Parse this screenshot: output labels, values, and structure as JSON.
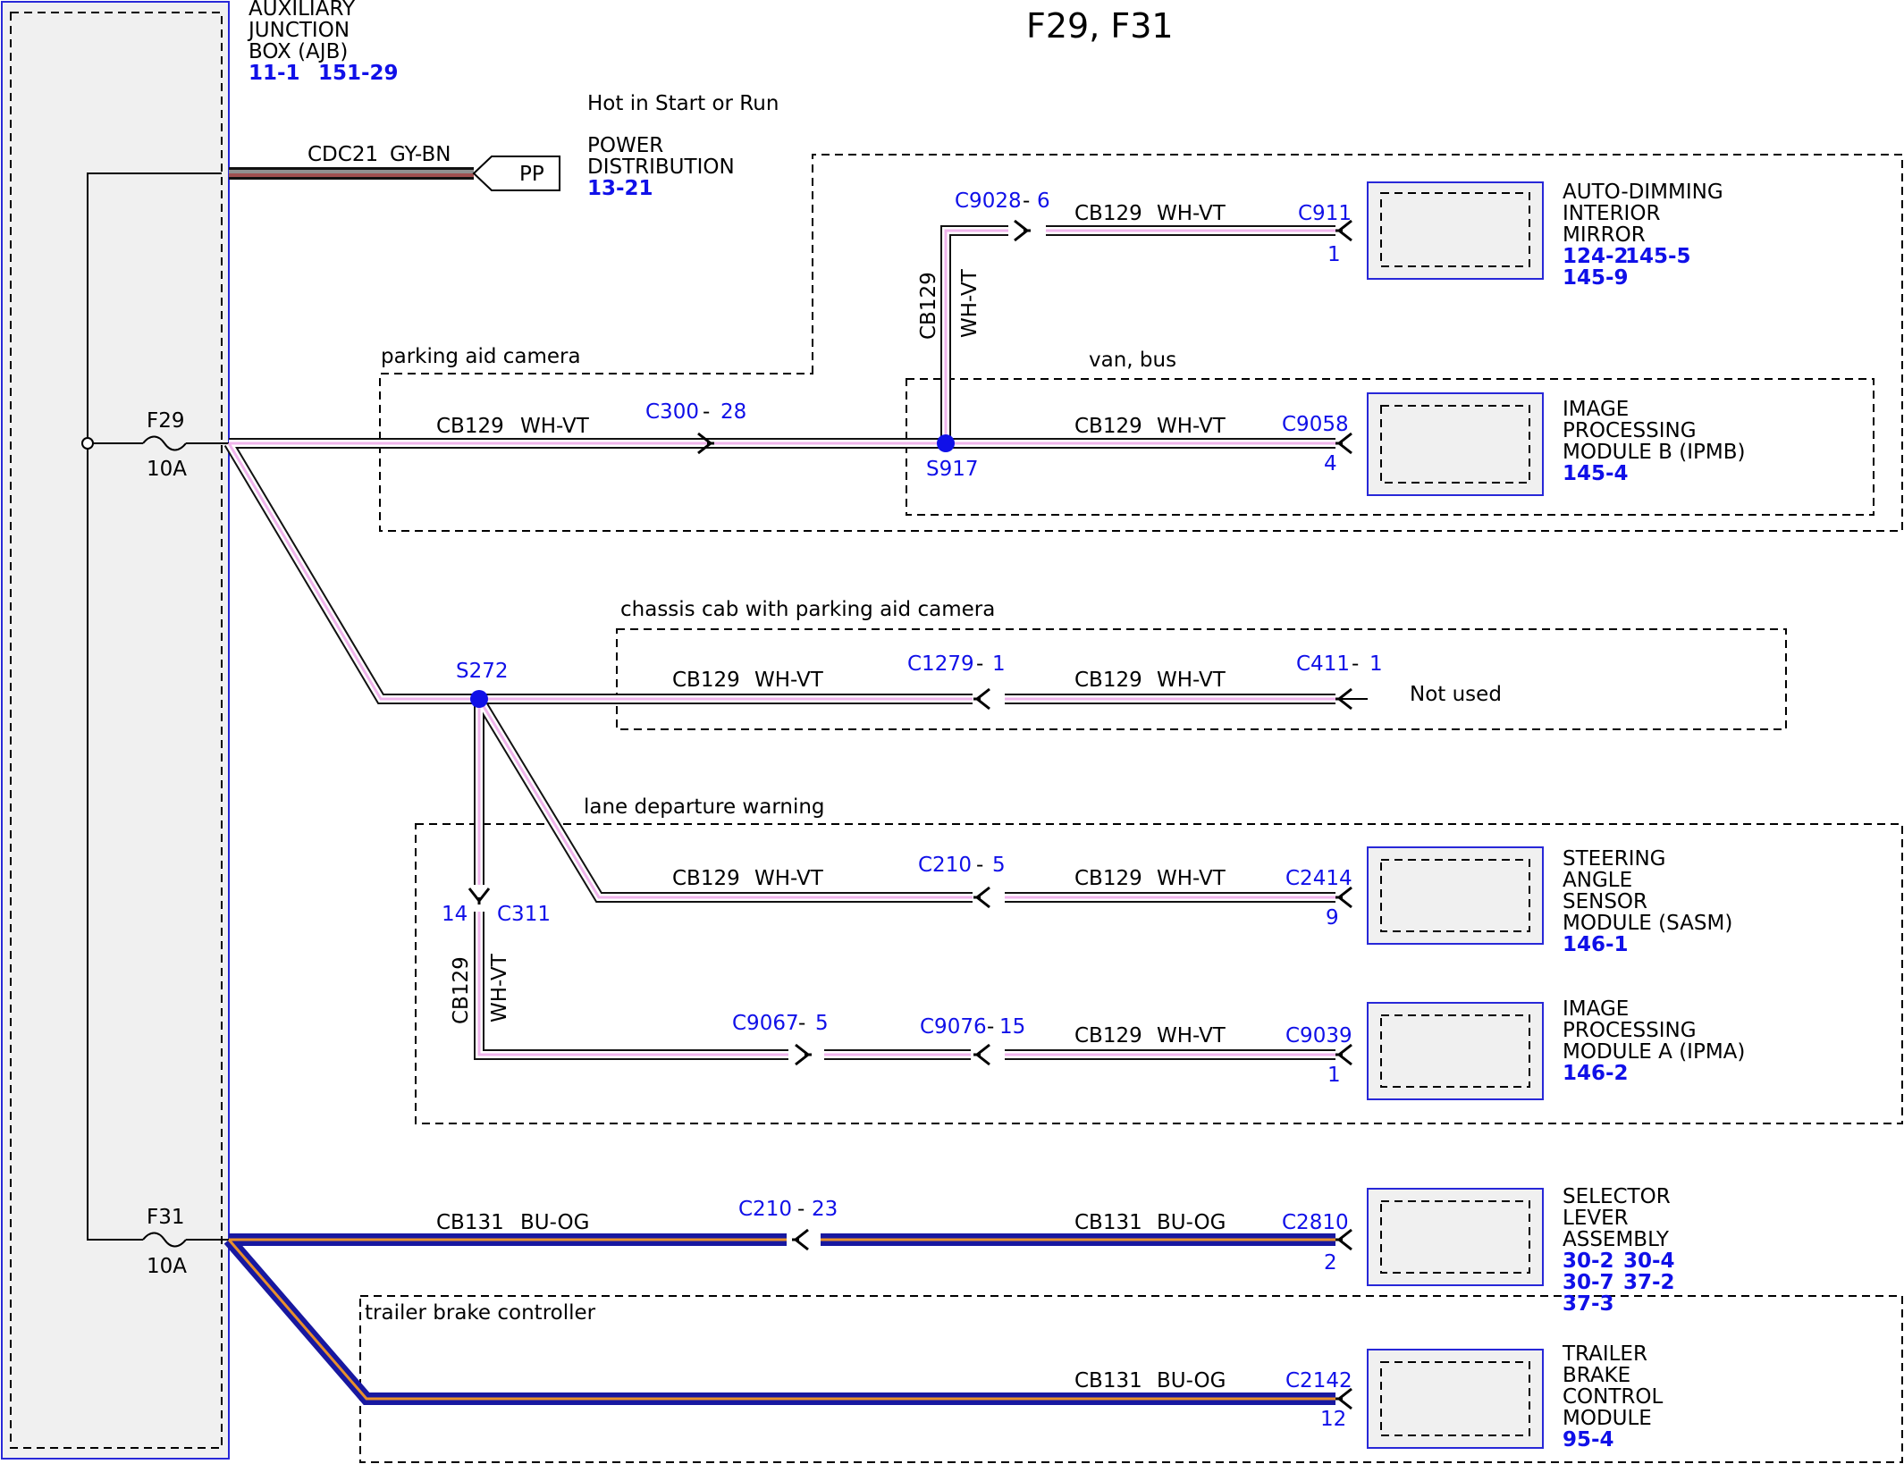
{
  "title": "F29, F31",
  "ajb": {
    "name_line1": "AUXILIARY",
    "name_line2": "JUNCTION",
    "name_line3": "BOX (AJB)",
    "ref1": "11-1",
    "ref2": "151-29"
  },
  "power_note": "Hot in Start or Run",
  "power_dist": {
    "line1": "POWER",
    "line2": "DISTRIBUTION",
    "ref": "13-21",
    "connector_label": "PP",
    "circuit": "CDC21",
    "color": "GY-BN"
  },
  "fuses": {
    "f29": {
      "name": "F29",
      "rating": "10A"
    },
    "f31": {
      "name": "F31",
      "rating": "10A"
    }
  },
  "zones": {
    "parking_aid_camera": "parking aid camera",
    "van_bus": "van, bus",
    "chassis_cab": "chassis cab with parking aid camera",
    "lane_departure": "lane departure warning",
    "trailer_brake": "trailer brake controller"
  },
  "splices": {
    "s917": "S917",
    "s272": "S272"
  },
  "wires": {
    "cb129": "CB129",
    "wh_vt": "WH-VT",
    "cb131": "CB131",
    "bu_og": "BU-OG"
  },
  "connectors": {
    "c9028": {
      "name": "C9028",
      "pin": "6"
    },
    "c911": {
      "name": "C911",
      "pin": "1"
    },
    "c300": {
      "name": "C300",
      "pin": "28"
    },
    "c9058": {
      "name": "C9058",
      "pin": "4"
    },
    "c1279": {
      "name": "C1279",
      "pin": "1"
    },
    "c411": {
      "name": "C411",
      "pin": "1"
    },
    "c311": {
      "name": "C311",
      "pin": "14"
    },
    "c210a": {
      "name": "C210",
      "pin": "5"
    },
    "c2414": {
      "name": "C2414",
      "pin": "9"
    },
    "c9067": {
      "name": "C9067",
      "pin": "5"
    },
    "c9076": {
      "name": "C9076",
      "pin": "15"
    },
    "c9039": {
      "name": "C9039",
      "pin": "1"
    },
    "c210b": {
      "name": "C210",
      "pin": "23"
    },
    "c2810": {
      "name": "C2810",
      "pin": "2"
    },
    "c2142": {
      "name": "C2142",
      "pin": "12"
    }
  },
  "not_used": "Not used",
  "dash": "-",
  "modules": {
    "mirror": {
      "line1": "AUTO-DIMMING",
      "line2": "INTERIOR",
      "line3": "MIRROR",
      "ref1": "124-2",
      "ref2": "145-5",
      "ref3": "145-9"
    },
    "ipmb": {
      "line1": "IMAGE",
      "line2": "PROCESSING",
      "line3": "MODULE B (IPMB)",
      "ref1": "145-4"
    },
    "sasm": {
      "line1": "STEERING",
      "line2": "ANGLE",
      "line3": "SENSOR",
      "line4": "MODULE (SASM)",
      "ref1": "146-1"
    },
    "ipma": {
      "line1": "IMAGE",
      "line2": "PROCESSING",
      "line3": "MODULE A (IPMA)",
      "ref1": "146-2"
    },
    "selector": {
      "line1": "SELECTOR",
      "line2": "LEVER",
      "line3": "ASSEMBLY",
      "ref1": "30-2",
      "ref2": "30-4",
      "ref3": "30-7",
      "ref4": "37-2",
      "ref5": "37-3"
    },
    "trailer": {
      "line1": "TRAILER",
      "line2": "BRAKE",
      "line3": "CONTROL",
      "line4": "MODULE",
      "ref1": "95-4"
    }
  },
  "colors": {
    "reference_blue": "#1010e8",
    "wire_pink": "#f0b4ec",
    "wire_blue": "#1818a0",
    "wire_orange": "#e8902c",
    "wire_gray": "#909090",
    "wire_brown": "#a05050",
    "ajb_fill": "#f0f0f0"
  }
}
